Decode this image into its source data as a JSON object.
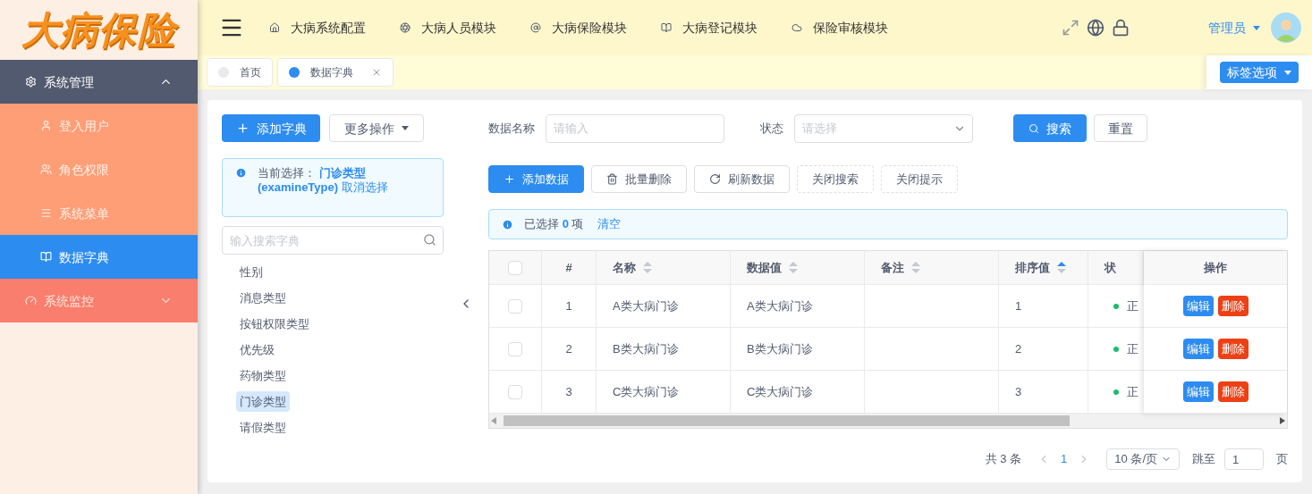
{
  "logo": {
    "text": "大病保险"
  },
  "sidebar": {
    "groups": [
      {
        "label": "系统管理",
        "expanded": true,
        "children": [
          {
            "label": "登入用户",
            "selected": false
          },
          {
            "label": "角色权限",
            "selected": false
          },
          {
            "label": "系统菜单",
            "selected": false
          },
          {
            "label": "数据字典",
            "selected": true
          }
        ]
      },
      {
        "label": "系统监控",
        "expanded": false
      }
    ]
  },
  "header": {
    "nav": [
      {
        "label": "大病系统配置"
      },
      {
        "label": "大病人员模块"
      },
      {
        "label": "大病保险模块"
      },
      {
        "label": "大病登记模块"
      },
      {
        "label": "保险审核模块"
      }
    ],
    "user": "管理员"
  },
  "tabs": [
    {
      "label": "首页",
      "selected": false,
      "closable": false
    },
    {
      "label": "数据字典",
      "selected": true,
      "closable": true
    }
  ],
  "tab_options": "标签选项",
  "left_panel": {
    "add_button": "添加字典",
    "more_button": "更多操作",
    "current": {
      "prefix": "当前选择：",
      "value": "门诊类型(examineType)",
      "cancel": "取消选择"
    },
    "search": {
      "placeholder": "输入搜索字典"
    },
    "items": [
      {
        "label": "性别",
        "selected": false
      },
      {
        "label": "消息类型",
        "selected": false
      },
      {
        "label": "按钮权限类型",
        "selected": false
      },
      {
        "label": "优先级",
        "selected": false
      },
      {
        "label": "药物类型",
        "selected": false
      },
      {
        "label": "门诊类型",
        "selected": true
      },
      {
        "label": "请假类型",
        "selected": false
      }
    ]
  },
  "filters": {
    "name_label": "数据名称",
    "name_placeholder": "请输入",
    "status_label": "状态",
    "status_placeholder": "请选择",
    "search_button": "搜索",
    "reset_button": "重置"
  },
  "toolbar": [
    {
      "label": "添加数据",
      "kind": "primary"
    },
    {
      "label": "批量删除",
      "kind": "default"
    },
    {
      "label": "刷新数据",
      "kind": "default"
    },
    {
      "label": "关闭搜索",
      "kind": "dashed"
    },
    {
      "label": "关闭提示",
      "kind": "dashed"
    }
  ],
  "selection": {
    "prefix": "已选择",
    "count": "0",
    "suffix": "项",
    "clear": "清空"
  },
  "table": {
    "header_checked": false,
    "columns": [
      {
        "label": "#",
        "sortable": false
      },
      {
        "label": "名称",
        "sortable": true,
        "ascending": false
      },
      {
        "label": "数据值",
        "sortable": true,
        "ascending": false
      },
      {
        "label": "备注",
        "sortable": true,
        "ascending": false
      },
      {
        "label": "排序值",
        "sortable": true,
        "ascending": true
      },
      {
        "label": "状",
        "sortable": false
      }
    ],
    "action_header": "操作",
    "rows": [
      {
        "checked": false,
        "index": "1",
        "name": "A类大病门诊",
        "value": "A类大病门诊",
        "sort": "1",
        "status": "正",
        "color": "#19be6b",
        "edit": "编辑",
        "delete": "删除"
      },
      {
        "checked": false,
        "index": "2",
        "name": "B类大病门诊",
        "value": "B类大病门诊",
        "sort": "2",
        "status": "正",
        "color": "#19be6b",
        "edit": "编辑",
        "delete": "删除"
      },
      {
        "checked": false,
        "index": "3",
        "name": "C类大病门诊",
        "value": "C类大病门诊",
        "sort": "3",
        "status": "正",
        "color": "#19be6b",
        "edit": "编辑",
        "delete": "删除"
      }
    ]
  },
  "pagination": {
    "total": "共 3 条",
    "pages": [
      {
        "label": "1",
        "selected": true
      }
    ],
    "page_size": "10 条/页",
    "jump_label": "跳至",
    "jump_value": "1",
    "page_suffix": "页"
  }
}
